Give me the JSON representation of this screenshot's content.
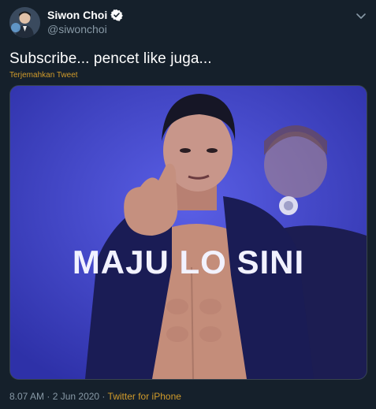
{
  "user": {
    "display_name": "Siwon Choi",
    "handle": "@siwonchoi"
  },
  "tweet": {
    "text": "Subscribe... pencet like juga...",
    "translate_label": "Terjemahkan Tweet",
    "media_caption": "MAJU LO SINI"
  },
  "meta": {
    "time": "8.07 AM",
    "separator": " · ",
    "date": "2 Jun 2020",
    "separator2": " · ",
    "source": "Twitter for iPhone"
  },
  "colors": {
    "background": "#15202b",
    "accent": "#d19b2b",
    "muted": "#8899a6",
    "verified_badge": "#ffffff"
  },
  "icons": {
    "verified": "verified-badge-icon",
    "caret": "chevron-down-icon"
  }
}
